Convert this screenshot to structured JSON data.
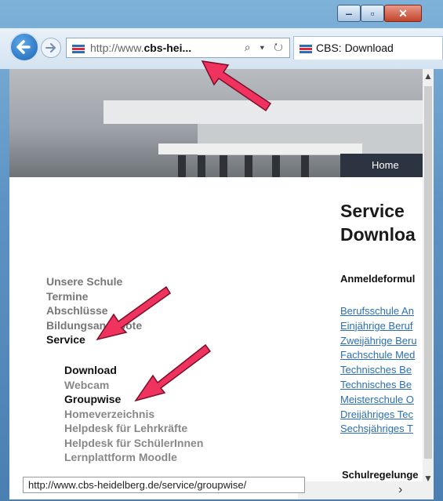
{
  "window": {
    "controls": {
      "minimize": "‒",
      "maximize": "▫",
      "close": "✕"
    }
  },
  "navbar": {
    "address": {
      "prefix": "http://www.",
      "domain": "cbs-hei...",
      "tools": "⌕ ▾ ↻"
    },
    "tab": {
      "title": "CBS: Download"
    }
  },
  "site": {
    "nav": {
      "home": "Home"
    },
    "heading": [
      "Service",
      "Downloa"
    ],
    "section1": "Anmeldeformul",
    "links": [
      "Berufsschule An",
      "Einjährige Beruf",
      "Zweijährige Beru",
      "Fachschule Med",
      "Technisches Be",
      "Technisches Be",
      "Meisterschule O",
      "Dreijähriges Tec",
      "Sechsjähriges T"
    ],
    "section2": "Schulregelunge",
    "menu": [
      "Unsere Schule",
      "Termine",
      "Abschlüsse",
      "Bildungsangebote",
      "Service"
    ],
    "submenu": [
      "Download",
      "Webcam",
      "Groupwise",
      "Homeverzeichnis",
      "Helpdesk für Lehrkräfte",
      "Helpdesk für SchülerInnen",
      "Lernplattform Moodle"
    ]
  },
  "statusbar": {
    "url": "http://www.cbs-heidelberg.de/service/groupwise/"
  },
  "colors": {
    "accent_arrow": "#f0325f",
    "link": "#2a6fb5",
    "nav_bg": "#2b3440"
  }
}
